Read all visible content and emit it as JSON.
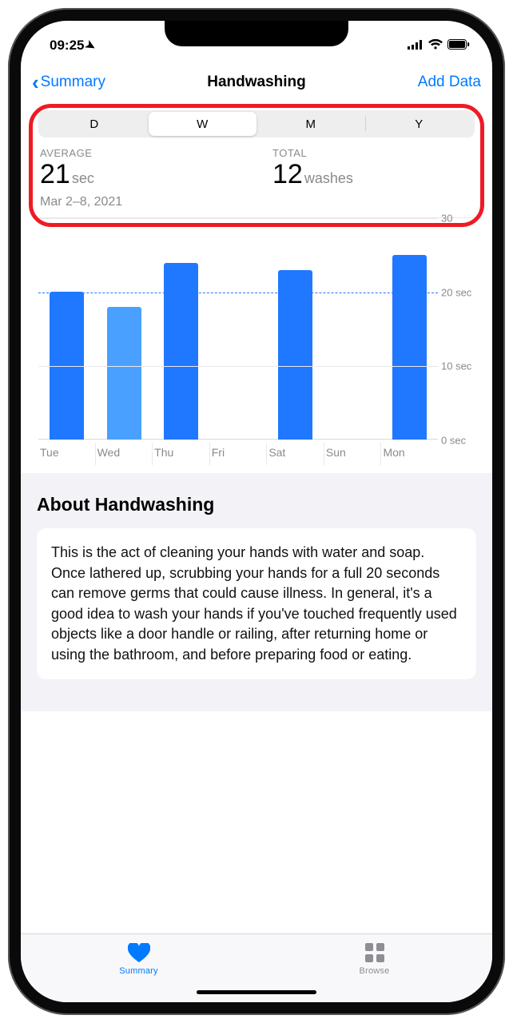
{
  "statusbar": {
    "time": "09:25"
  },
  "nav": {
    "back_label": "Summary",
    "title": "Handwashing",
    "add_label": "Add Data"
  },
  "segmented": {
    "options": [
      "D",
      "W",
      "M",
      "Y"
    ],
    "selected_index": 1
  },
  "stats": {
    "avg_label": "AVERAGE",
    "avg_value": "21",
    "avg_unit": "sec",
    "total_label": "TOTAL",
    "total_value": "12",
    "total_unit": "washes",
    "date_range": "Mar 2–8, 2021"
  },
  "chart_data": {
    "type": "bar",
    "categories": [
      "Tue",
      "Wed",
      "Thu",
      "Fri",
      "Sat",
      "Sun",
      "Mon"
    ],
    "values": [
      20,
      18,
      24,
      null,
      23,
      null,
      25
    ],
    "highlight_index": 1,
    "reference_line": 20,
    "ylabel": "",
    "ylim": [
      0,
      30
    ],
    "y_ticks": [
      {
        "v": 0,
        "label": "0 sec"
      },
      {
        "v": 10,
        "label": "10 sec"
      },
      {
        "v": 20,
        "label": "20 sec"
      },
      {
        "v": 30,
        "label": "30"
      }
    ]
  },
  "about": {
    "heading": "About Handwashing",
    "body": "This is the act of cleaning your hands with water and soap. Once lathered up, scrubbing your hands for a full 20 seconds can remove germs that could cause illness. In general, it's a good idea to wash your hands if you've touched frequently used objects like a door handle or railing, after returning home or using the bathroom, and before preparing food or eating."
  },
  "tabs": {
    "summary": "Summary",
    "browse": "Browse"
  }
}
